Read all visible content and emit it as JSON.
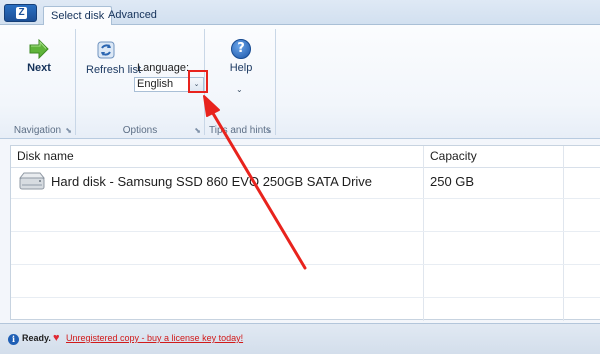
{
  "app_menu": {
    "glyph": "Z"
  },
  "tabs": [
    {
      "label": "Select disk",
      "active": true
    },
    {
      "label": "Advanced",
      "active": false
    }
  ],
  "ribbon": {
    "navigation": {
      "group_label": "Navigation",
      "next_label": "Next"
    },
    "options": {
      "group_label": "Options",
      "refresh_label": "Refresh list",
      "language_label": "Language:",
      "language_value": "English",
      "dropdown_glyph": "⌄"
    },
    "tips": {
      "group_label": "Tips and hints",
      "help_label": "Help",
      "help_glyph": "?",
      "more_glyph": "⌄"
    }
  },
  "grid": {
    "columns": [
      {
        "label": "Disk name"
      },
      {
        "label": "Capacity"
      }
    ],
    "rows": [
      {
        "name": "Hard disk - Samsung SSD 860 EVO 250GB SATA Drive",
        "capacity": "250 GB",
        "icon": "hard-disk-icon"
      }
    ]
  },
  "status": {
    "info_glyph": "i",
    "ready_text": "Ready.",
    "heart_glyph": "♥",
    "license_text": "Unregistered copy - buy a license key today!"
  },
  "colors": {
    "accent": "#1f5fb5",
    "annotation": "#e8231d",
    "link": "#d11a1a"
  }
}
